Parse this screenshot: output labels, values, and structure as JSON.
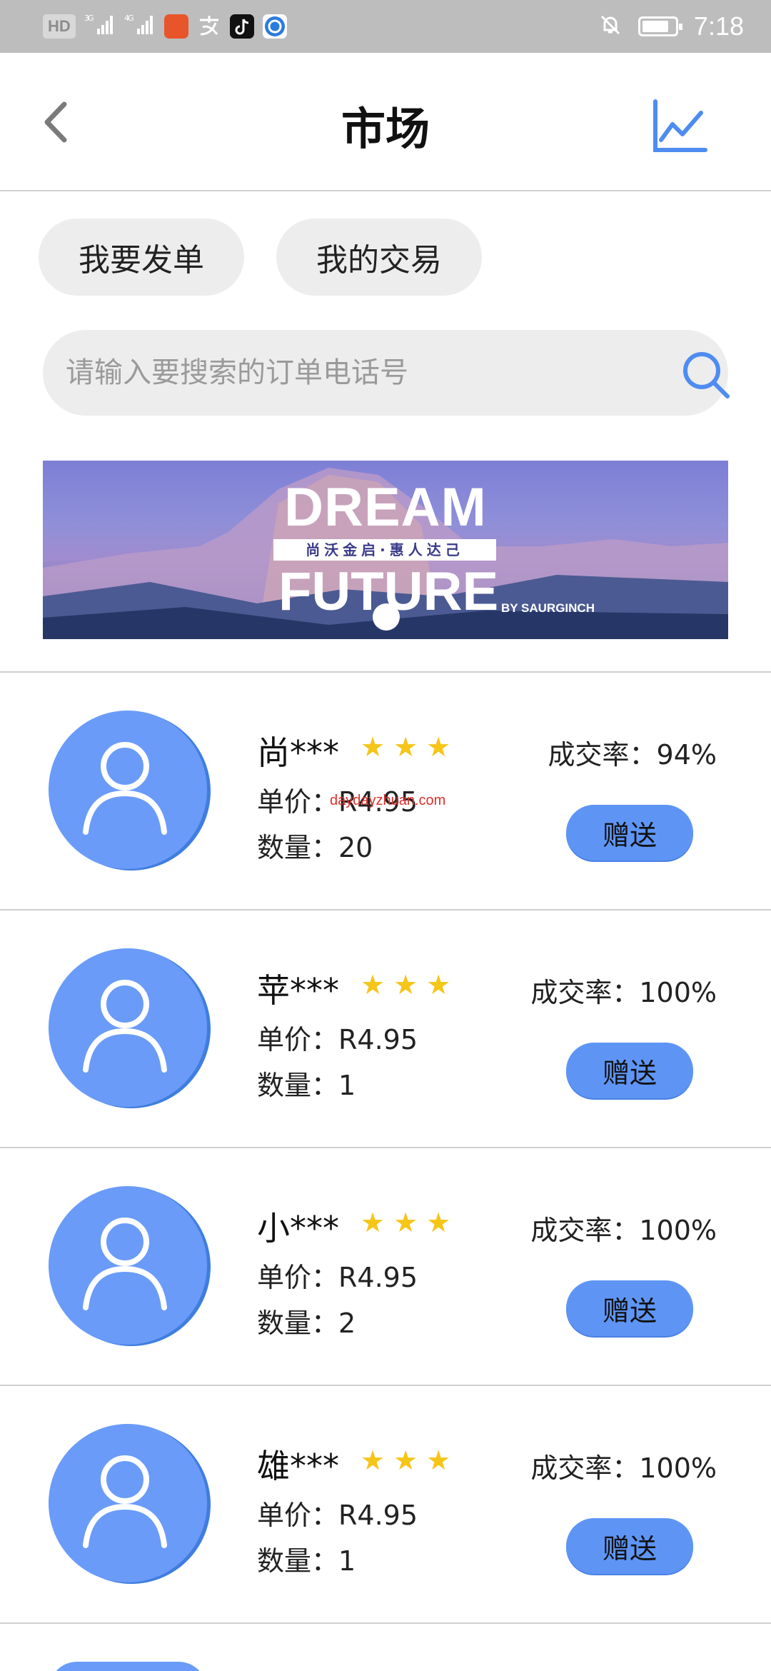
{
  "status_bar": {
    "hd_badge": "HD",
    "signal1": "3G",
    "signal2": "4G",
    "time": "7:18",
    "battery_level": 0.75,
    "app_icons": [
      "orange-app-icon",
      "alipay-icon",
      "tiktok-icon",
      "blue-circle-app-icon"
    ]
  },
  "header": {
    "title": "市场",
    "accent_color": "#4e8cf2"
  },
  "actions": {
    "post_order": "我要发单",
    "my_trades": "我的交易"
  },
  "search": {
    "placeholder": "请输入要搜索的订单电话号"
  },
  "banner": {
    "line1": "DREAM",
    "motto": "尚沃金启·惠人达己",
    "line2": "FUTURE",
    "byline": "BY SAURGINCH"
  },
  "watermark": "daydayzhuan.com",
  "listings": [
    {
      "name": "尚***",
      "stars": 3,
      "price": "单价：R4.95",
      "quantity": "数量：20",
      "rate": "成交率：94%",
      "action": "赠送"
    },
    {
      "name": "苹***",
      "stars": 3,
      "price": "单价：R4.95",
      "quantity": "数量：1",
      "rate": "成交率：100%",
      "action": "赠送"
    },
    {
      "name": "小***",
      "stars": 3,
      "price": "单价：R4.95",
      "quantity": "数量：2",
      "rate": "成交率：100%",
      "action": "赠送"
    },
    {
      "name": "雄***",
      "stars": 3,
      "price": "单价：R4.95",
      "quantity": "数量：1",
      "rate": "成交率：100%",
      "action": "赠送"
    }
  ]
}
